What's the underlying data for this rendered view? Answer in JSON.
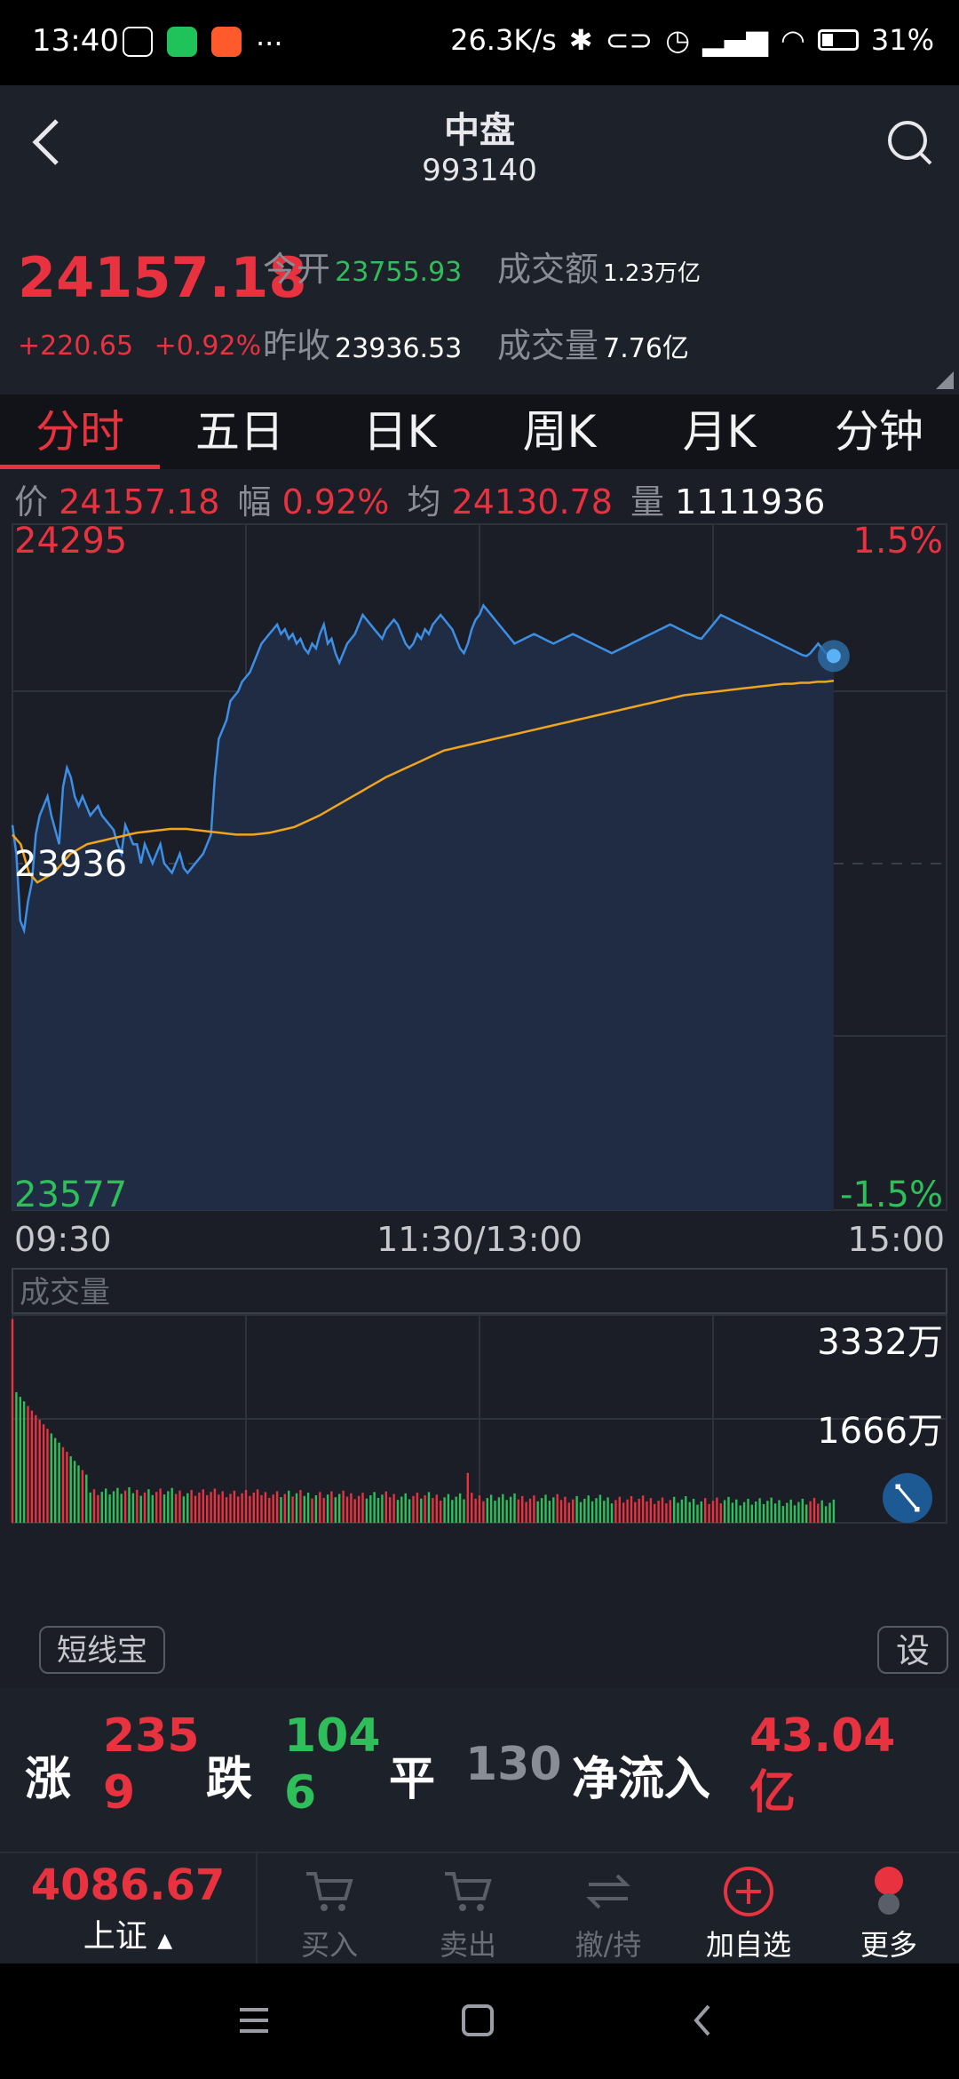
{
  "status_bar": {
    "time": "13:40",
    "net_speed": "26.3K/s",
    "battery": "31%",
    "more": "···"
  },
  "header": {
    "title": "中盘",
    "code": "993140"
  },
  "quote": {
    "price": "24157.18",
    "change": "+220.65",
    "change_pct": "+0.92%",
    "open_label": "今开",
    "open_value": "23755.93",
    "amount_label": "成交额",
    "amount_value": "1.23万亿",
    "prev_close_label": "昨收",
    "prev_close_value": "23936.53",
    "volume_label": "成交量",
    "volume_value": "7.76亿"
  },
  "tabs": [
    "分时",
    "五日",
    "日K",
    "周K",
    "月K",
    "分钟"
  ],
  "info_line": {
    "price_label": "价",
    "price_value": "24157.18",
    "amp_label": "幅",
    "amp_value": "0.92%",
    "avg_label": "均",
    "avg_value": "24130.78",
    "vol_label": "量",
    "vol_value": "1111936"
  },
  "chart_data": {
    "type": "line",
    "y_labels": {
      "top": "24295",
      "mid": "23936",
      "bottom": "23577"
    },
    "pct_labels": {
      "top": "1.5%",
      "bottom": "-1.5%"
    },
    "x_labels": [
      "09:30",
      "11:30/13:00",
      "15:00"
    ],
    "ylim": [
      23577,
      24295
    ],
    "prev_close": 23936,
    "volume_title": "成交量",
    "volume_labels": {
      "top": "3332万",
      "mid": "1666万"
    },
    "volume_max": 3332,
    "colors": {
      "price": "#3d8fe6",
      "avg": "#f0a51c",
      "up": "#e8323f",
      "down": "#2fbf5a"
    },
    "series": [
      {
        "values": [
          23980,
          23950,
          23880,
          23870,
          23900,
          23920,
          23970,
          23990,
          24000,
          24010,
          23990,
          23975,
          23960,
          24020,
          24040,
          24030,
          24010,
          24000,
          24010,
          24000,
          23990,
          23995,
          24000,
          23990,
          23985,
          23980,
          23975,
          23960,
          23950,
          23980,
          23970,
          23960,
          23960,
          23940,
          23960,
          23950,
          23940,
          23950,
          23960,
          23940,
          23935,
          23930,
          23940,
          23950,
          23935,
          23930,
          23935,
          23940,
          23945,
          23950,
          23960,
          23970,
          24030,
          24070,
          24080,
          24090,
          24110,
          24115,
          24120,
          24130,
          24135,
          24140,
          24150,
          24160,
          24170,
          24175,
          24180,
          24185,
          24190,
          24180,
          24185,
          24175,
          24180,
          24170,
          24175,
          24165,
          24160,
          24170,
          24165,
          24180,
          24190,
          24170,
          24175,
          24160,
          24150,
          24160,
          24170,
          24175,
          24180,
          24190,
          24200,
          24195,
          24190,
          24185,
          24180,
          24175,
          24185,
          24190,
          24195,
          24190,
          24180,
          24170,
          24165,
          24170,
          24180,
          24175,
          24185,
          24180,
          24190,
          24195,
          24200,
          24195,
          24190,
          24185,
          24175,
          24165,
          24160,
          24170,
          24185,
          24195,
          24200,
          24210,
          24205,
          24200,
          24195,
          24190,
          24185,
          24180,
          24175,
          24170,
          24172,
          24174,
          24176,
          24178,
          24180,
          24178,
          24176,
          24174,
          24172,
          24170,
          24172,
          24174,
          24176,
          24178,
          24180,
          24178,
          24176,
          24174,
          24172,
          24170,
          24168,
          24166,
          24164,
          24162,
          24160,
          24162,
          24164,
          24166,
          24168,
          24170,
          24172,
          24174,
          24176,
          24178,
          24180,
          24182,
          24184,
          24186,
          24188,
          24190,
          24188,
          24186,
          24184,
          24182,
          24180,
          24178,
          24176,
          24175,
          24180,
          24185,
          24190,
          24195,
          24200,
          24198,
          24196,
          24194,
          24192,
          24190,
          24188,
          24186,
          24184,
          24182,
          24180,
          24178,
          24176,
          24174,
          24172,
          24170,
          24168,
          24166,
          24164,
          24162,
          24160,
          24158,
          24157,
          24160,
          24165,
          24170,
          24165,
          24160,
          24158,
          24157
        ]
      },
      {
        "values": [
          23970,
          23960,
          23930,
          23920,
          23925,
          23930,
          23940,
          23950,
          23955,
          23960,
          23962,
          23964,
          23966,
          23968,
          23970,
          23972,
          23973,
          23974,
          23975,
          23976,
          23976,
          23976,
          23975,
          23974,
          23973,
          23972,
          23971,
          23970,
          23970,
          23970,
          23971,
          23972,
          23974,
          23976,
          23978,
          23982,
          23986,
          23990,
          23995,
          24000,
          24005,
          24010,
          24015,
          24020,
          24025,
          24030,
          24034,
          24038,
          24042,
          24046,
          24050,
          24054,
          24058,
          24060,
          24062,
          24064,
          24066,
          24068,
          24070,
          24072,
          24074,
          24076,
          24078,
          24080,
          24082,
          24084,
          24086,
          24088,
          24090,
          24092,
          24094,
          24096,
          24098,
          24100,
          24102,
          24104,
          24106,
          24108,
          24110,
          24112,
          24114,
          24116,
          24117,
          24118,
          24119,
          24120,
          24121,
          24122,
          24123,
          24124,
          24125,
          24126,
          24127,
          24128,
          24128,
          24129,
          24129,
          24130,
          24130,
          24131
        ]
      }
    ]
  },
  "short_line_label": "短线宝",
  "settings_label": "设",
  "breadth": {
    "up_label": "涨",
    "up_value_1": "235",
    "up_value_2": "9",
    "down_label": "跌",
    "down_value_1": "104",
    "down_value_2": "6",
    "flat_label": "平",
    "flat_value": "130",
    "flow_label": "净流入",
    "flow_value_1": "43.04",
    "flow_value_2": "亿"
  },
  "trade_bar": {
    "index_value": "4086.67",
    "index_name": "上证",
    "buy": "买入",
    "sell": "卖出",
    "cancel": "撤/持",
    "add_watch": "加自选",
    "more": "更多"
  }
}
